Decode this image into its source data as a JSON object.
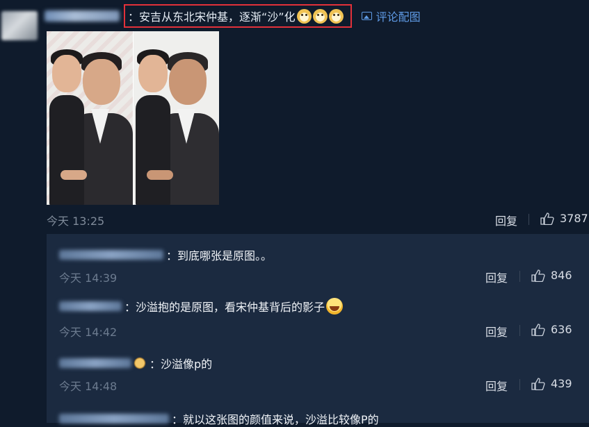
{
  "post": {
    "comment_text": "：安吉从东北宋仲基，逐渐“沙”化",
    "emoji_icons": [
      "dog-face-icon",
      "dog-face-icon",
      "dog-face-icon"
    ],
    "view_image_link": "评论配图",
    "time": "今天 13:25",
    "reply_label": "回复",
    "likes": "3787"
  },
  "replies": [
    {
      "text": "：到底哪张是原图。。",
      "time": "今天 14:39",
      "reply_label": "回复",
      "likes": "846"
    },
    {
      "text": "：沙溢抱的是原图，看宋仲基背后的影子",
      "emoji": "laughing-face-icon",
      "time": "今天 14:42",
      "reply_label": "回复",
      "likes": "636"
    },
    {
      "text": "：沙溢像p的",
      "time": "今天 14:48",
      "reply_label": "回复",
      "likes": "439"
    },
    {
      "text": "：就以这张图的颜值来说，沙溢比较像P的"
    }
  ],
  "colors": {
    "background": "#0f1b2c",
    "reply_panel": "#1b2a40",
    "link_blue": "#5f9be6",
    "highlight_red": "#e3313a"
  }
}
